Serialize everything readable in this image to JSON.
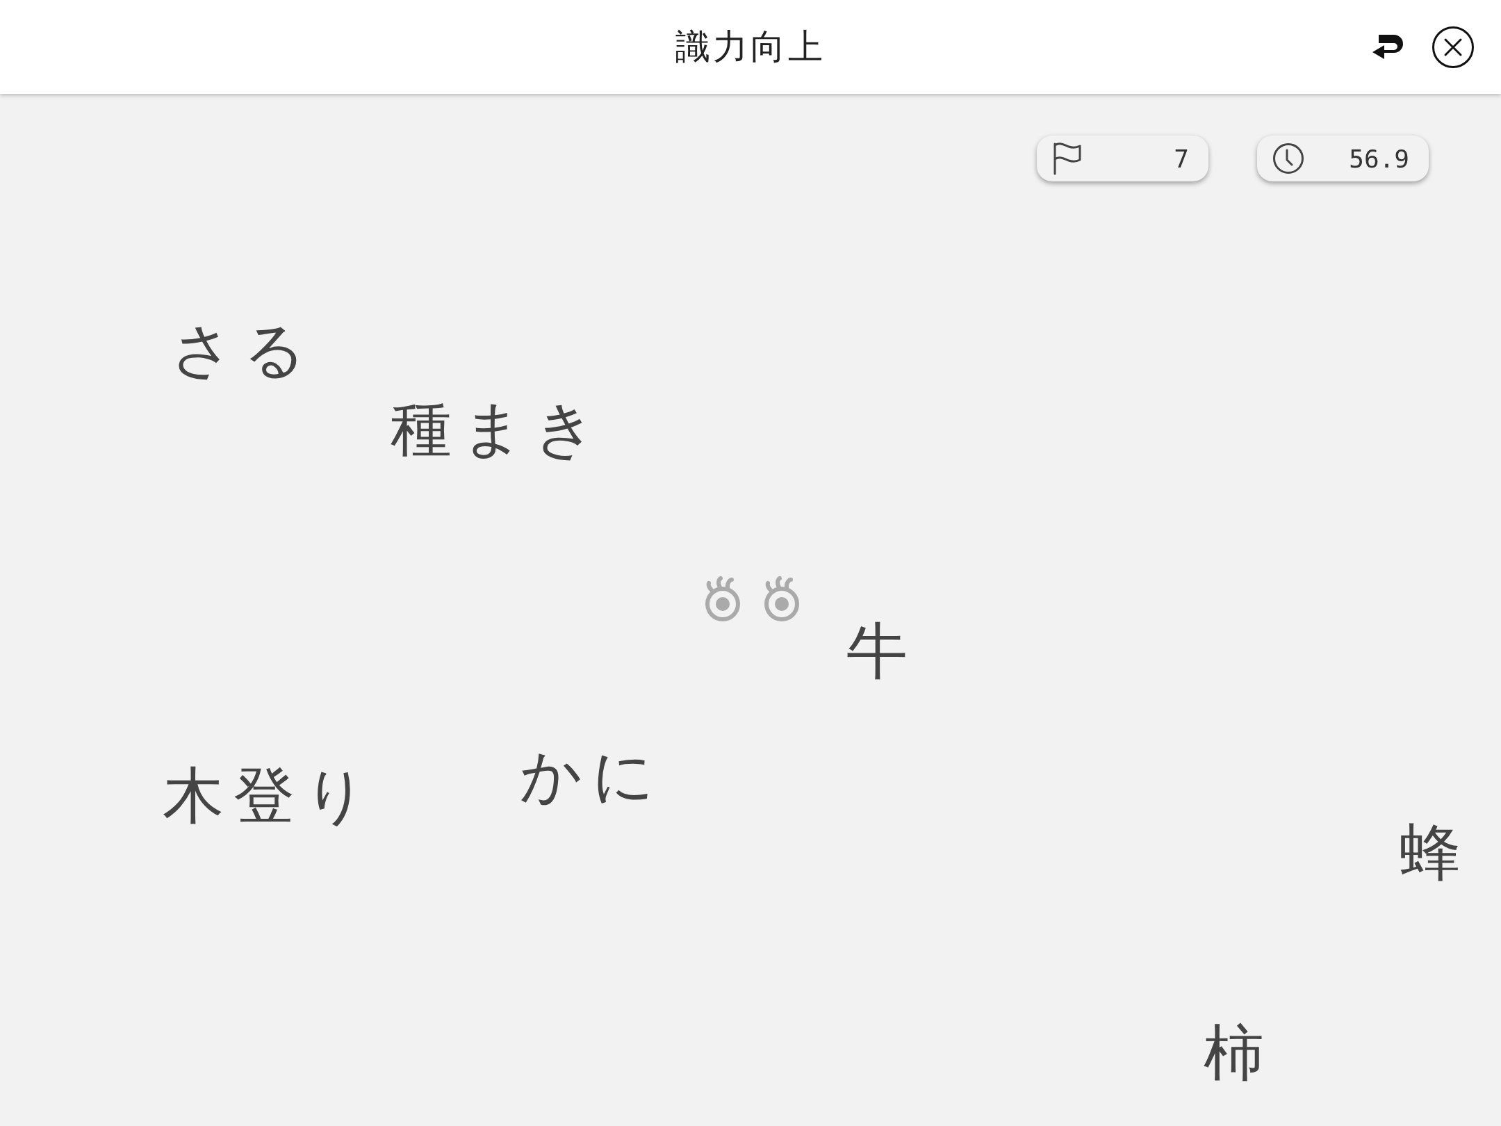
{
  "header": {
    "title": "識力向上"
  },
  "stats": [
    {
      "kind": "flag",
      "value": "7"
    },
    {
      "kind": "timer",
      "value": "56.9"
    }
  ],
  "words": [
    "さる",
    "種まき",
    "牛",
    "かに",
    "木登り",
    "蜂",
    "柿"
  ]
}
